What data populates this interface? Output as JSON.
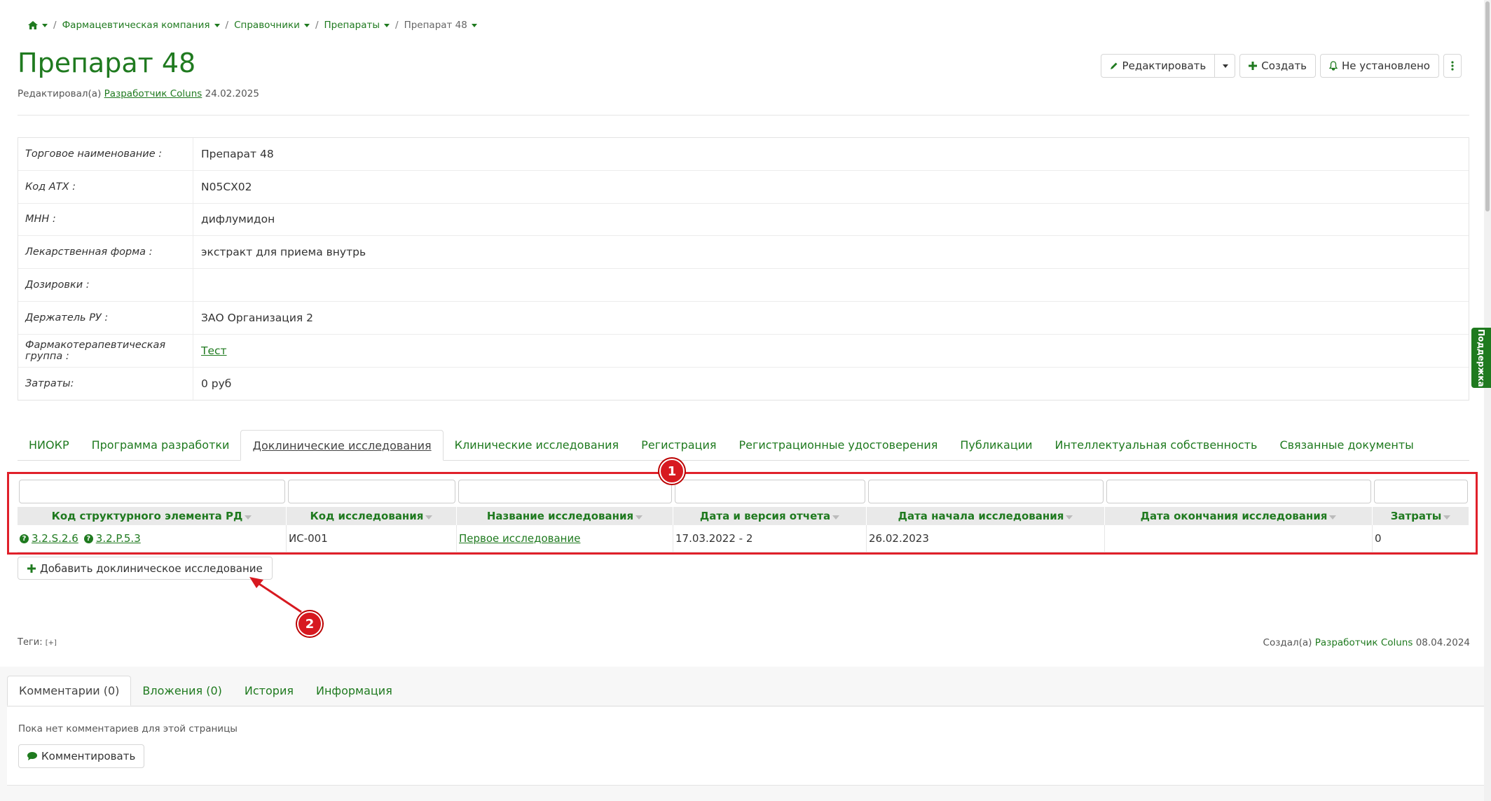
{
  "breadcrumb": {
    "items": [
      "Фармацевтическая компания",
      "Справочники",
      "Препараты"
    ],
    "current": "Препарат 48",
    "separator": "/"
  },
  "page": {
    "title": "Препарат 48",
    "edited_prefix": "Редактировал(а)",
    "edited_user": "Разработчик Coluns",
    "edited_date": "24.02.2025"
  },
  "toolbar": {
    "edit_label": "Редактировать",
    "create_label": "Создать",
    "notify_label": "Не установлено"
  },
  "info": [
    {
      "label": "Торговое наименование :",
      "value": "Препарат 48",
      "link": false
    },
    {
      "label": "Код АТХ :",
      "value": "N05CX02",
      "link": false
    },
    {
      "label": "МНН :",
      "value": "дифлумидон",
      "link": false
    },
    {
      "label": "Лекарственная форма :",
      "value": "экстракт для приема внутрь",
      "link": false
    },
    {
      "label": "Дозировки :",
      "value": "",
      "link": false
    },
    {
      "label": "Держатель РУ :",
      "value": "ЗАО Организация 2",
      "link": false
    },
    {
      "label": "Фармакотерапевтическая группа :",
      "value": "Тест",
      "link": true
    },
    {
      "label": "Затраты:",
      "value": "0 руб",
      "link": false
    }
  ],
  "tabs": [
    "НИОКР",
    "Программа разработки",
    "Доклинические исследования",
    "Клинические исследования",
    "Регистрация",
    "Регистрационные удостоверения",
    "Публикации",
    "Интеллектуальная собственность",
    "Связанные документы"
  ],
  "active_tab": 2,
  "study_table": {
    "columns": [
      "Код структурного элемента РД",
      "Код исследования",
      "Название исследования",
      "Дата и версия отчета",
      "Дата начала исследования",
      "Дата окончания исследования",
      "Затраты"
    ],
    "rows": [
      {
        "codes": [
          "3.2.S.2.6",
          "3.2.P.5.3"
        ],
        "study_code": "ИС-001",
        "name": "Первое исследование",
        "report": "17.03.2022 - 2",
        "start": "26.02.2023",
        "end": "",
        "cost": "0"
      }
    ]
  },
  "add_study_label": "Добавить доклиническое исследование",
  "annotations": {
    "marker1": "1",
    "marker2": "2"
  },
  "tags": {
    "label": "Теги:",
    "add": "[+]"
  },
  "created": {
    "prefix": "Создал(а)",
    "user": "Разработчик Coluns",
    "date": "08.04.2024"
  },
  "comments": {
    "tabs": [
      "Комментарии (0)",
      "Вложения (0)",
      "История",
      "Информация"
    ],
    "empty_text": "Пока нет комментариев для этой страницы",
    "comment_button": "Комментировать"
  },
  "support_label": "Поддержка",
  "colors": {
    "accent": "#1f7a1f",
    "annotation": "#e0202a"
  }
}
